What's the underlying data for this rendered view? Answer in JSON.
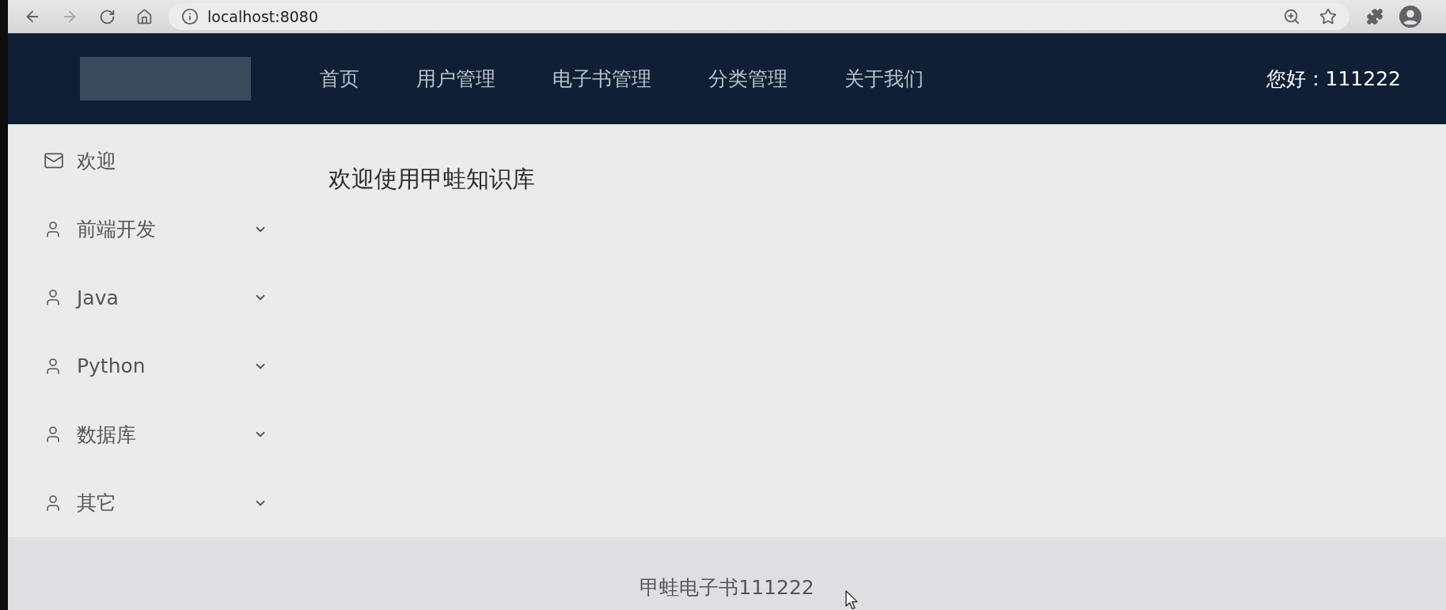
{
  "browser": {
    "address": "localhost:8080",
    "forward_enabled": false
  },
  "header": {
    "nav": [
      {
        "label": "首页",
        "selected": false
      },
      {
        "label": "用户管理",
        "selected": false
      },
      {
        "label": "电子书管理",
        "selected": false
      },
      {
        "label": "分类管理",
        "selected": false
      },
      {
        "label": "关于我们",
        "selected": false
      }
    ],
    "greeting": "您好：111222"
  },
  "sidebar": {
    "items": [
      {
        "kind": "item",
        "label": "欢迎",
        "selected": false
      },
      {
        "kind": "submenu",
        "label": "前端开发",
        "selected": false,
        "expanded": false
      },
      {
        "kind": "submenu",
        "label": "Java",
        "selected": false,
        "expanded": false
      },
      {
        "kind": "submenu",
        "label": "Python",
        "selected": false,
        "expanded": false
      },
      {
        "kind": "submenu",
        "label": "数据库",
        "selected": false,
        "expanded": false
      },
      {
        "kind": "submenu",
        "label": "其它",
        "selected": false,
        "expanded": false
      }
    ]
  },
  "content": {
    "title": "欢迎使用甲蛙知识库"
  },
  "footer": {
    "text": "甲蛙电子书111222"
  }
}
